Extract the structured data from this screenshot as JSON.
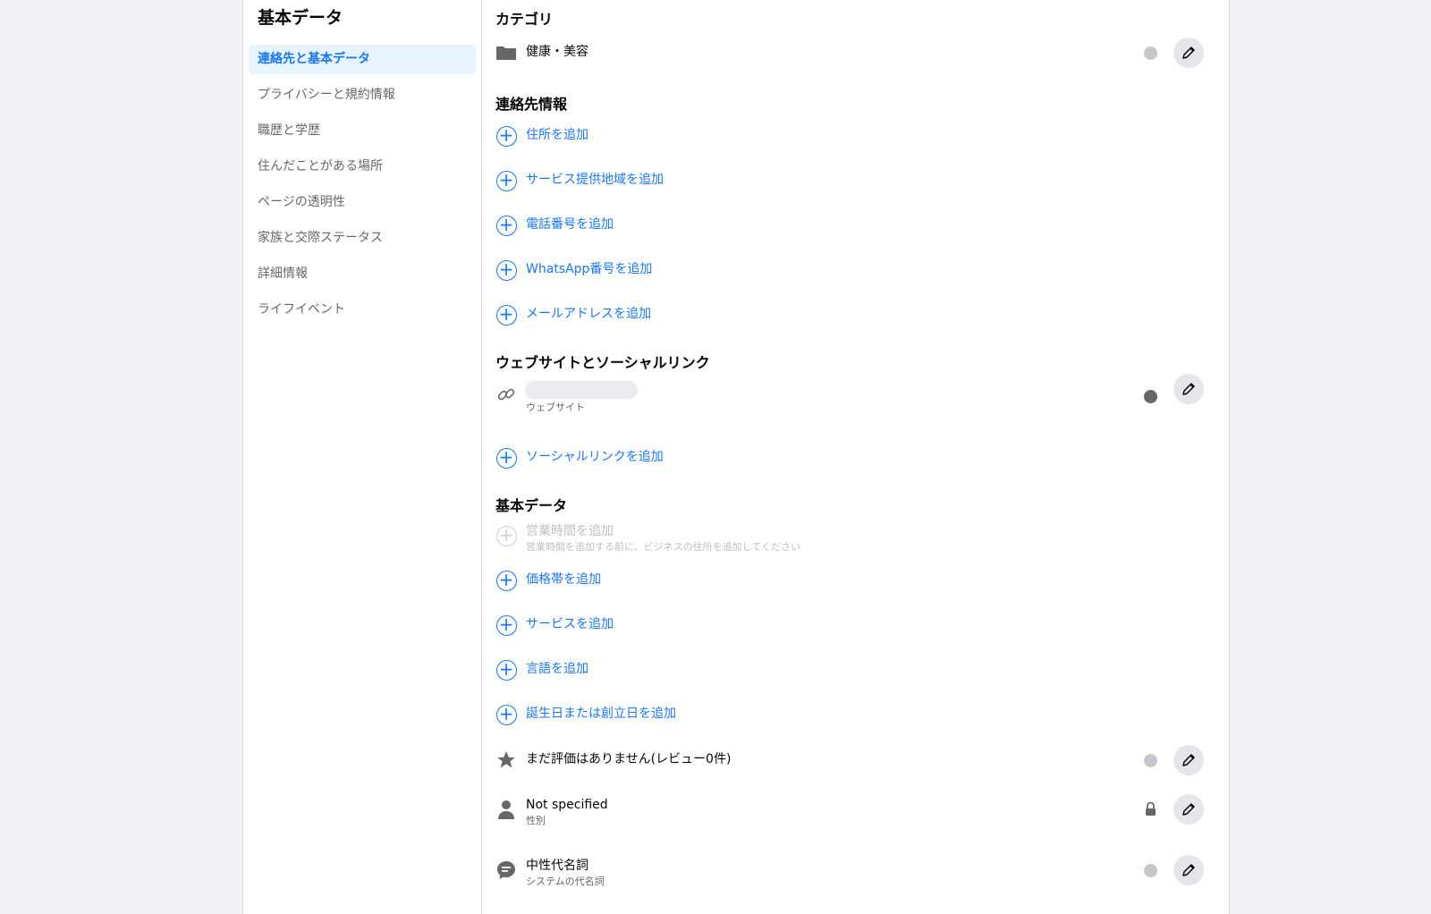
{
  "sidebar": {
    "title": "基本データ",
    "items": [
      {
        "label": "連絡先と基本データ",
        "active": true
      },
      {
        "label": "プライバシーと規約情報"
      },
      {
        "label": "職歴と学歴"
      },
      {
        "label": "住んだことがある場所"
      },
      {
        "label": "ページの透明性"
      },
      {
        "label": "家族と交際ステータス"
      },
      {
        "label": "詳細情報"
      },
      {
        "label": "ライフイベント"
      }
    ]
  },
  "category": {
    "title": "カテゴリ",
    "value": "健康・美容"
  },
  "contact": {
    "title": "連絡先情報",
    "add_address": "住所を追加",
    "add_service_area": "サービス提供地域を追加",
    "add_phone": "電話番号を追加",
    "add_whatsapp": "WhatsApp番号を追加",
    "add_email": "メールアドレスを追加"
  },
  "websites": {
    "title": "ウェブサイトとソーシャルリンク",
    "website_label": "ウェブサイト",
    "add_social": "ソーシャルリンクを追加"
  },
  "basic": {
    "title": "基本データ",
    "add_hours": "営業時間を追加",
    "add_hours_hint": "営業時間を追加する前に、ビジネスの住所を追加してください",
    "add_price_range": "価格帯を追加",
    "add_services": "サービスを追加",
    "add_language": "言語を追加",
    "add_birthday": "誕生日または創立日を追加",
    "rating": "まだ評価はありません(レビュー0件)",
    "gender_value": "Not specified",
    "gender_label": "性別",
    "pronoun_value": "中性代名詞",
    "pronoun_label": "システムの代名詞"
  },
  "colors": {
    "accent": "#1877f2",
    "active_bg": "#e7f3ff",
    "secondary_text": "#65676b",
    "page_bg": "#f0f2f5"
  }
}
